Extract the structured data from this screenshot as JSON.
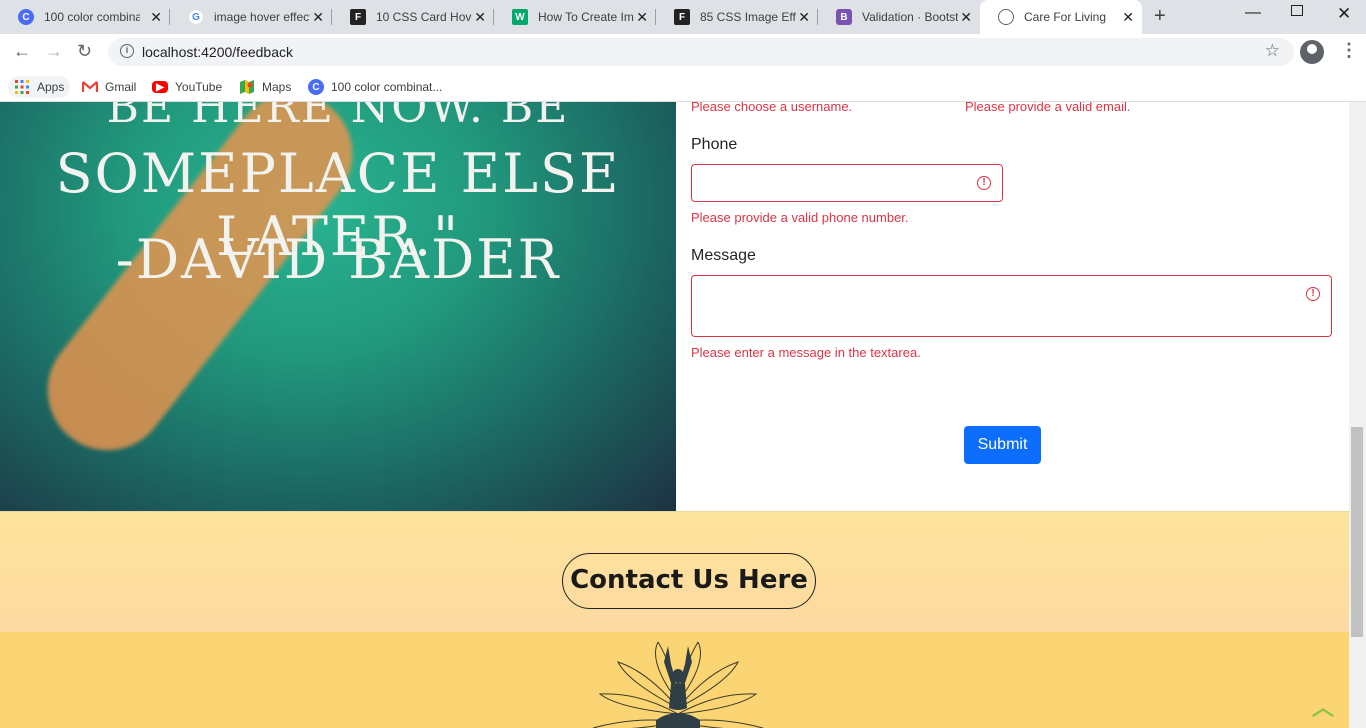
{
  "tabs": [
    {
      "title": "100 color combina",
      "favicon": "C",
      "color": "#4a6cf7"
    },
    {
      "title": "image hover effect",
      "favicon": "G",
      "color": "#4285f4"
    },
    {
      "title": "10 CSS Card Hover",
      "favicon": "F",
      "color": "#222222"
    },
    {
      "title": "How To Create Ima",
      "favicon": "W",
      "color": "#04aa6d"
    },
    {
      "title": "85 CSS Image Effe",
      "favicon": "F",
      "color": "#222222"
    },
    {
      "title": "Validation · Bootst",
      "favicon": "B",
      "color": "#7952b3"
    },
    {
      "title": "Care For Living",
      "favicon": "globe",
      "color": "#5f6368"
    }
  ],
  "address_bar": {
    "url": "localhost:4200/feedback"
  },
  "bookmarks": [
    {
      "label": "Apps",
      "icon": "apps-grid-icon"
    },
    {
      "label": "Gmail",
      "icon": "gmail-icon"
    },
    {
      "label": "YouTube",
      "icon": "youtube-icon"
    },
    {
      "label": "Maps",
      "icon": "maps-icon"
    },
    {
      "label": "100 color combinat...",
      "icon": "c-icon"
    }
  ],
  "quote": {
    "line1": "BE HERE NOW. BE",
    "line2": "SOMEPLACE ELSE LATER.\"",
    "line3": "-DAVID BADER"
  },
  "form": {
    "username_error": "Please choose a username.",
    "email_error": "Please provide a valid email.",
    "phone_label": "Phone",
    "phone_value": "",
    "phone_error": "Please provide a valid phone number.",
    "message_label": "Message",
    "message_value": "",
    "message_error": "Please enter a message in the textarea.",
    "submit_label": "Submit"
  },
  "contact": {
    "button_label": "Contact Us Here"
  },
  "colors": {
    "error": "#dc3545",
    "primary": "#0d6efd",
    "band": "#fde49c",
    "footer": "#fbd473"
  }
}
